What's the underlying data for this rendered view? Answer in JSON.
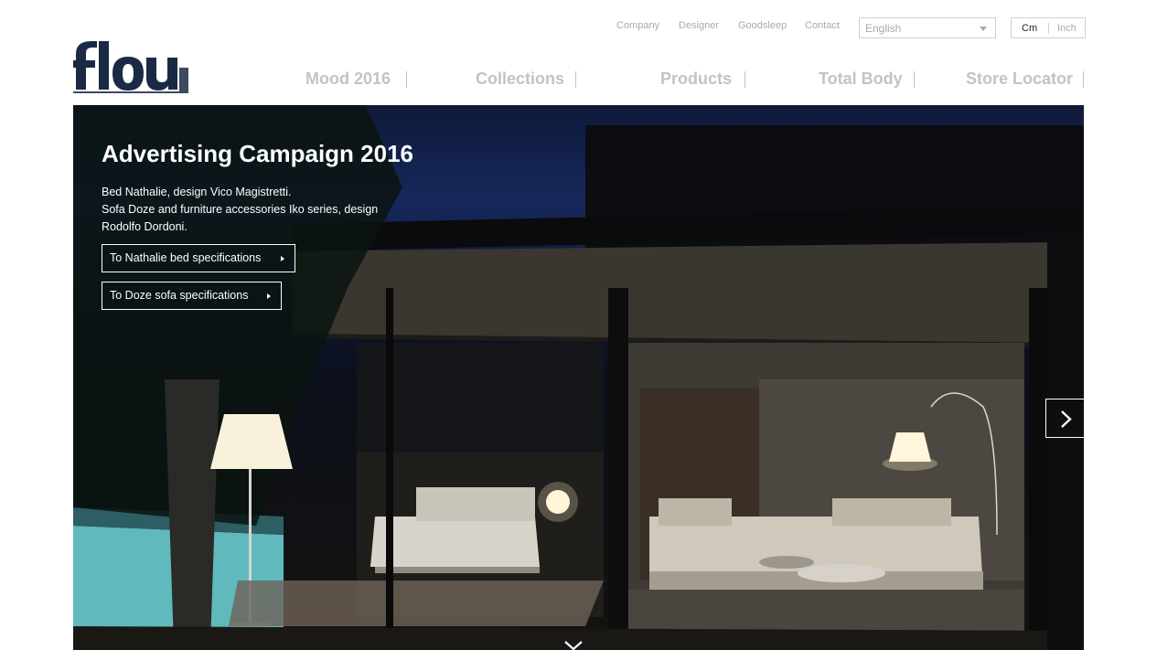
{
  "utility_nav": {
    "items": [
      "Company",
      "Designer",
      "Goodsleep",
      "Contact"
    ]
  },
  "language": {
    "selected": "English"
  },
  "units": {
    "cm": "Cm",
    "inch": "Inch",
    "active": "cm"
  },
  "logo": {
    "text": "Flou",
    "color": "#1b2a44"
  },
  "main_nav": {
    "items": [
      "Mood 2016",
      "Collections",
      "Products",
      "Total Body",
      "Store Locator"
    ]
  },
  "hero": {
    "title": "Advertising Campaign 2016",
    "description": [
      "Bed Nathalie, design Vico Magistretti.",
      "Sofa Doze and furniture accessories Iko series, design",
      "Rodolfo Dordoni."
    ],
    "buttons": [
      "To Nathalie bed specifications",
      "To Doze sofa specifications"
    ],
    "next_icon": "chevron-right-icon",
    "scroll_icon": "chevron-down-icon"
  },
  "colors": {
    "nav_text": "#c3c3c3",
    "utility_text": "#a9a9a9",
    "hero_text": "#ffffff"
  }
}
